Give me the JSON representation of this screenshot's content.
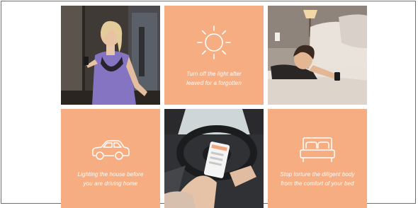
{
  "tiles": {
    "photo_elevator": {
      "icon": "photo-woman-elevator-phone"
    },
    "light": {
      "icon": "sun-icon",
      "caption_line1": "Turn off the light after",
      "caption_line2": "leaved for a forgotten",
      "color": "#f7ad82"
    },
    "photo_bed": {
      "icon": "photo-woman-bed-phone"
    },
    "car": {
      "icon": "car-icon",
      "caption_line1": "Lighting the house before",
      "caption_line2": "you are driving home",
      "color": "#f7ad82"
    },
    "photo_car": {
      "icon": "photo-driver-phone-app"
    },
    "bed": {
      "icon": "bed-icon",
      "caption_line1": "Stop torture the diligent body",
      "caption_line2": "from the comfort of your bed",
      "color": "#f7ad82"
    }
  }
}
